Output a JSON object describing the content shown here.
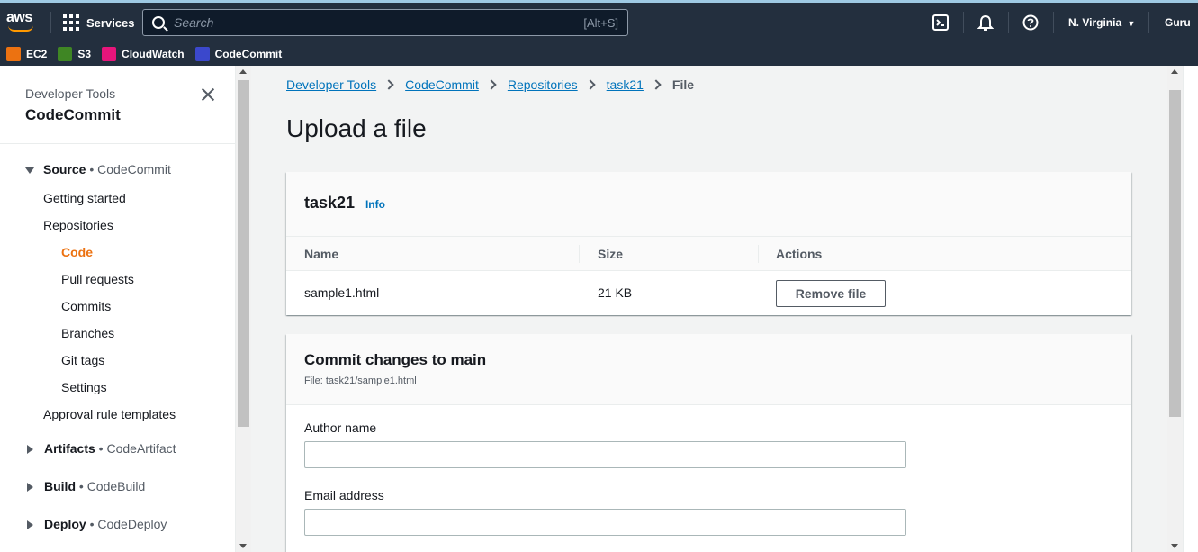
{
  "topnav": {
    "logo_text": "aws",
    "services_label": "Services",
    "search_placeholder": "Search",
    "search_shortcut": "[Alt+S]",
    "region": "N. Virginia",
    "user": "Guru"
  },
  "favorites": [
    {
      "label": "EC2",
      "color": "#ec7211"
    },
    {
      "label": "S3",
      "color": "#3f8624"
    },
    {
      "label": "CloudWatch",
      "color": "#e7157b"
    },
    {
      "label": "CodeCommit",
      "color": "#3b48cc"
    }
  ],
  "sidebar": {
    "subtitle": "Developer Tools",
    "title": "CodeCommit",
    "source": {
      "name": "Source",
      "service": "CodeCommit"
    },
    "items": [
      "Getting started",
      "Repositories",
      "Code",
      "Pull requests",
      "Commits",
      "Branches",
      "Git tags",
      "Settings",
      "Approval rule templates"
    ],
    "artifacts": {
      "name": "Artifacts",
      "service": "CodeArtifact"
    },
    "build": {
      "name": "Build",
      "service": "CodeBuild"
    },
    "deploy": {
      "name": "Deploy",
      "service": "CodeDeploy"
    }
  },
  "breadcrumb": [
    "Developer Tools",
    "CodeCommit",
    "Repositories",
    "task21",
    "File"
  ],
  "page_title": "Upload a file",
  "repo_panel": {
    "title": "task21",
    "info": "Info",
    "columns": [
      "Name",
      "Size",
      "Actions"
    ],
    "row": {
      "name": "sample1.html",
      "size": "21 KB",
      "action": "Remove file"
    }
  },
  "commit_panel": {
    "title": "Commit changes to main",
    "file": "File: task21/sample1.html",
    "author_label": "Author name",
    "author_value": "",
    "email_label": "Email address",
    "email_value": ""
  }
}
